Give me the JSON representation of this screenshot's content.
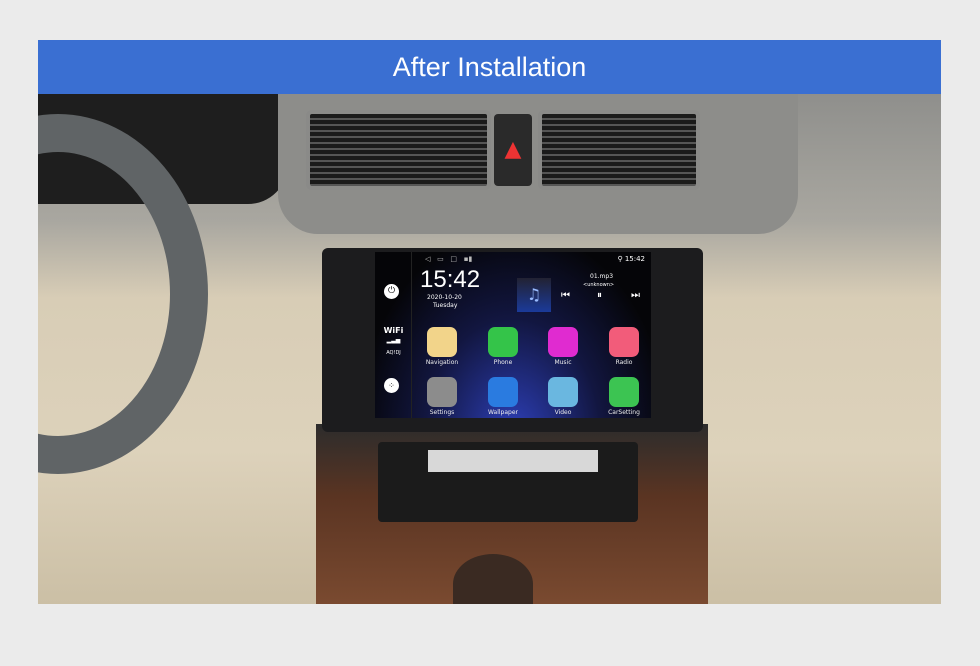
{
  "banner": {
    "title": "After Installation"
  },
  "screen": {
    "status_time": "15:42",
    "clock": "15:42",
    "date": "2020-10-20",
    "day": "Tuesday",
    "wifi": "WiFi",
    "network": "AQ!DJ",
    "music": {
      "track": "01.mp3",
      "artist": "<unknown>"
    },
    "apps": [
      {
        "label": "Navigation",
        "color": "#f2d48a",
        "icon": "navigation-icon"
      },
      {
        "label": "Phone",
        "color": "#34c449",
        "icon": "phone-icon"
      },
      {
        "label": "Music",
        "color": "#e02bd0",
        "icon": "music-icon"
      },
      {
        "label": "Radio",
        "color": "#f25c7a",
        "icon": "radio-icon"
      },
      {
        "label": "Settings",
        "color": "#8c8c8c",
        "icon": "settings-icon"
      },
      {
        "label": "Wallpaper",
        "color": "#2a7be0",
        "icon": "wallpaper-icon"
      },
      {
        "label": "Video",
        "color": "#6ab7e0",
        "icon": "video-icon"
      },
      {
        "label": "CarSetting",
        "color": "#3cc452",
        "icon": "car-setting-icon"
      }
    ]
  }
}
